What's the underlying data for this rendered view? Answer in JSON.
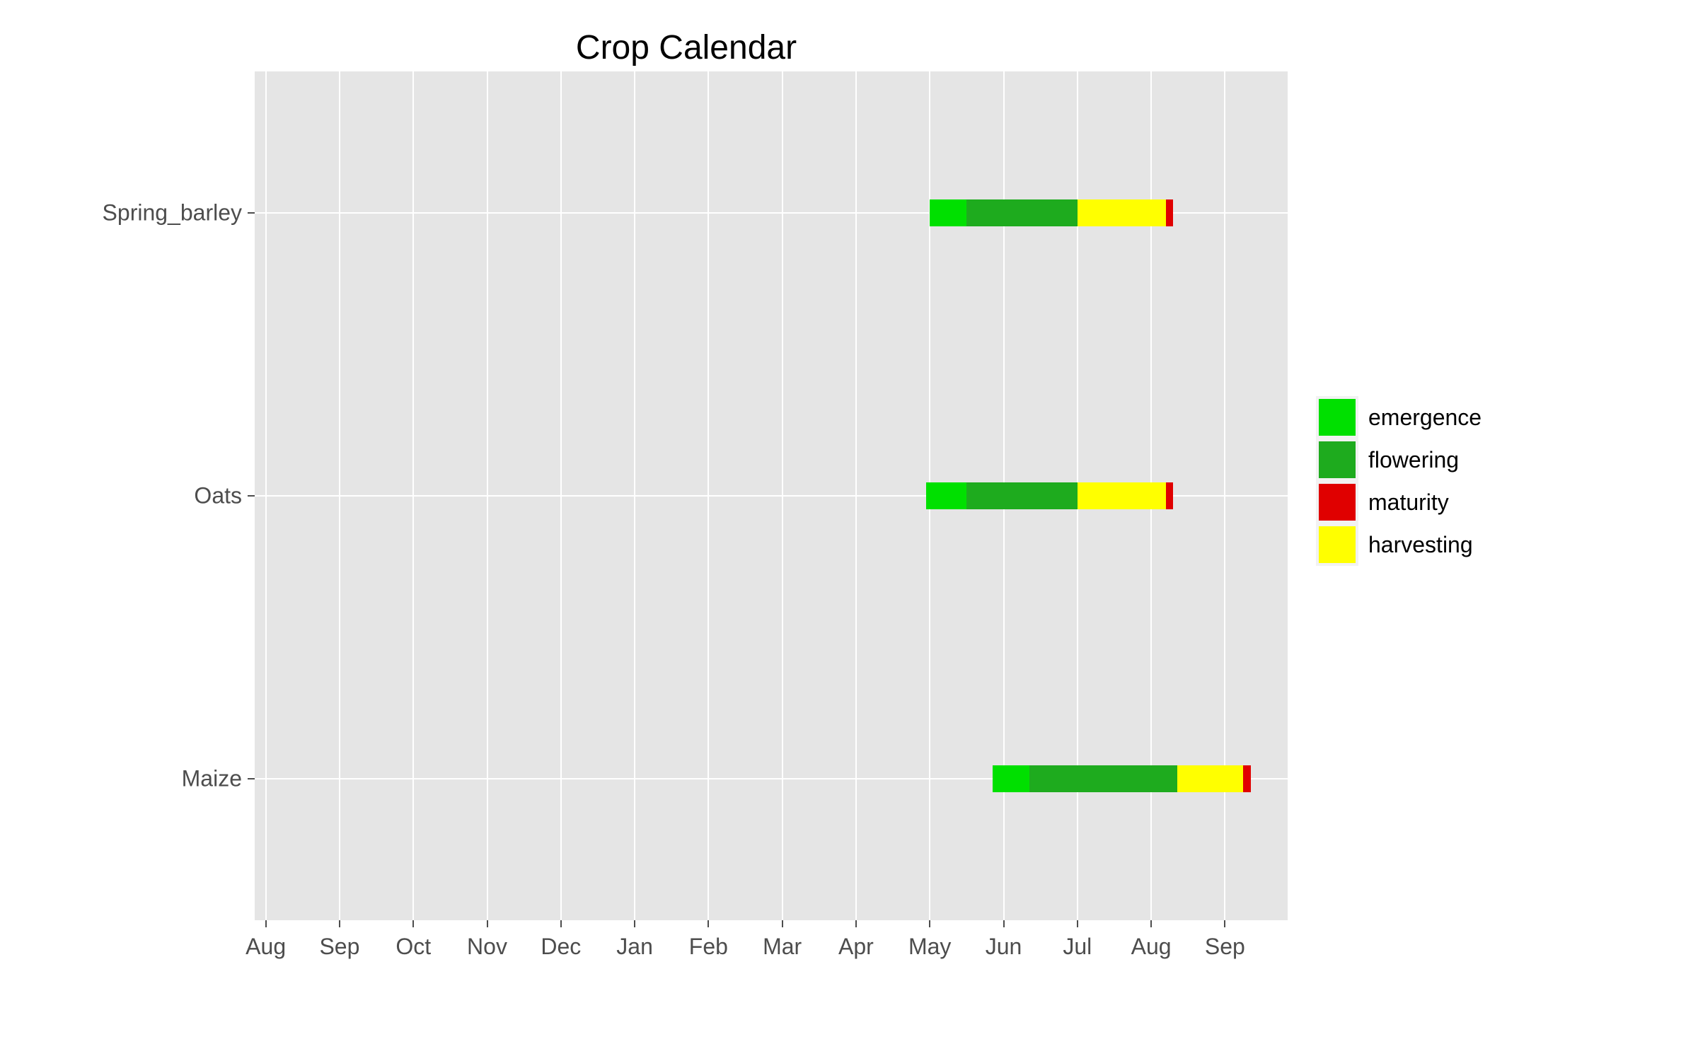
{
  "chart_data": {
    "type": "bar",
    "title": "Crop Calendar",
    "xlabel": "",
    "ylabel": "",
    "x_axis": {
      "type": "month",
      "ticks": [
        "Aug",
        "Sep",
        "Oct",
        "Nov",
        "Dec",
        "Jan",
        "Feb",
        "Mar",
        "Apr",
        "May",
        "Jun",
        "Jul",
        "Aug",
        "Sep"
      ],
      "range_months_from_start": [
        0,
        14
      ]
    },
    "categories": [
      "Spring_barley",
      "Oats",
      "Maize"
    ],
    "series": [
      {
        "name": "emergence",
        "color": "#00e000",
        "intervals": {
          "Spring_barley": [
            9.0,
            9.5
          ],
          "Oats": [
            8.95,
            9.5
          ],
          "Maize": [
            9.85,
            10.35
          ]
        }
      },
      {
        "name": "flowering",
        "color": "#1eab1e",
        "intervals": {
          "Spring_barley": [
            9.5,
            11.0
          ],
          "Oats": [
            9.5,
            11.0
          ],
          "Maize": [
            10.35,
            12.35
          ]
        }
      },
      {
        "name": "harvesting",
        "color": "#ffff00",
        "intervals": {
          "Spring_barley": [
            11.0,
            12.2
          ],
          "Oats": [
            11.0,
            12.2
          ],
          "Maize": [
            12.35,
            13.25
          ]
        }
      },
      {
        "name": "maturity",
        "color": "#e00000",
        "intervals": {
          "Spring_barley": [
            12.2,
            12.3
          ],
          "Oats": [
            12.2,
            12.3
          ],
          "Maize": [
            13.25,
            13.35
          ]
        }
      }
    ],
    "legend": {
      "position": "right",
      "order": [
        "emergence",
        "flowering",
        "maturity",
        "harvesting"
      ]
    }
  }
}
